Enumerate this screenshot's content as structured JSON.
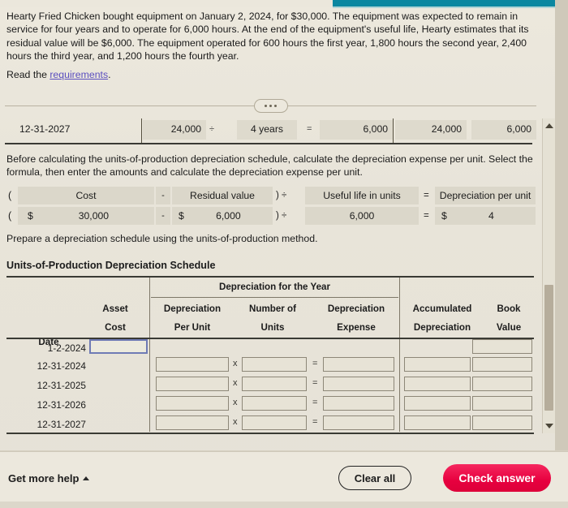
{
  "problem": {
    "statement": "Hearty Fried Chicken bought equipment on January 2, 2024, for $30,000. The equipment was expected to remain in service for four years and to operate for 6,000 hours. At the end of the equipment's useful life, Hearty estimates that its residual value will be $6,000. The equipment operated for 600 hours the first year, 1,800 hours the second year, 2,400 hours the third year, and 1,200 hours the fourth year.",
    "read_prefix": "Read the ",
    "read_link": "requirements",
    "read_suffix": "."
  },
  "previous_row": {
    "date": "12-31-2027",
    "depreciable_cost": "24,000",
    "op1": "÷",
    "useful_life": "4 years",
    "op2": "=",
    "expense": "6,000",
    "accumulated": "24,000",
    "book_value": "6,000"
  },
  "instructions": {
    "before_formula": "Before calculating the units-of-production depreciation schedule, calculate the depreciation expense per unit. Select the formula, then enter the amounts and calculate the depreciation expense per unit.",
    "prepare_schedule": "Prepare a depreciation schedule using the units-of-production method."
  },
  "formula": {
    "open_paren": "(",
    "header": {
      "cost": "Cost",
      "minus": "-",
      "residual": "Residual value",
      "close_div": ") ÷",
      "useful_life": "Useful life in units",
      "equals": "=",
      "result": "Depreciation per unit"
    },
    "values": {
      "open_paren": "(",
      "cost_sym": "$",
      "cost": "30,000",
      "minus": "-",
      "residual_sym": "$",
      "residual": "6,000",
      "close_div": ") ÷",
      "useful_life": "6,000",
      "equals": "=",
      "result_sym": "$",
      "result": "4"
    }
  },
  "schedule": {
    "title": "Units-of-Production Depreciation Schedule",
    "group_header": "Depreciation for the Year",
    "columns": [
      {
        "line1": "",
        "line2": "Date"
      },
      {
        "line1": "Asset",
        "line2": "Cost"
      },
      {
        "line1": "Depreciation",
        "line2": "Per Unit"
      },
      {
        "line1": "Number of",
        "line2": "Units"
      },
      {
        "line1": "Depreciation",
        "line2": "Expense"
      },
      {
        "line1": "Accumulated",
        "line2": "Depreciation"
      },
      {
        "line1": "Book",
        "line2": "Value"
      }
    ],
    "rows": [
      {
        "date": "1-2-2024",
        "type": "initial",
        "asset_cost": "",
        "per_unit": "",
        "units": "",
        "expense": "",
        "accumulated": "",
        "book_value": ""
      },
      {
        "date": "12-31-2024",
        "type": "year",
        "asset_cost": "",
        "per_unit": "",
        "units": "",
        "expense": "",
        "accumulated": "",
        "book_value": ""
      },
      {
        "date": "12-31-2025",
        "type": "year",
        "asset_cost": "",
        "per_unit": "",
        "units": "",
        "expense": "",
        "accumulated": "",
        "book_value": ""
      },
      {
        "date": "12-31-2026",
        "type": "year",
        "asset_cost": "",
        "per_unit": "",
        "units": "",
        "expense": "",
        "accumulated": "",
        "book_value": ""
      },
      {
        "date": "12-31-2027",
        "type": "year",
        "asset_cost": "",
        "per_unit": "",
        "units": "",
        "expense": "",
        "accumulated": "",
        "book_value": ""
      }
    ],
    "operators": {
      "multiply": "x",
      "equals": "="
    }
  },
  "footer": {
    "get_more_help": "Get more help",
    "clear_all": "Clear all",
    "check_answer": "Check answer"
  },
  "colors": {
    "accent_teal": "#0b87a0",
    "check_button": "#e7003f",
    "link": "#5b4fbf",
    "page_background": "#e9e5da",
    "cell_fill": "#dbd7ca",
    "focus_border": "#6f7bb5"
  }
}
